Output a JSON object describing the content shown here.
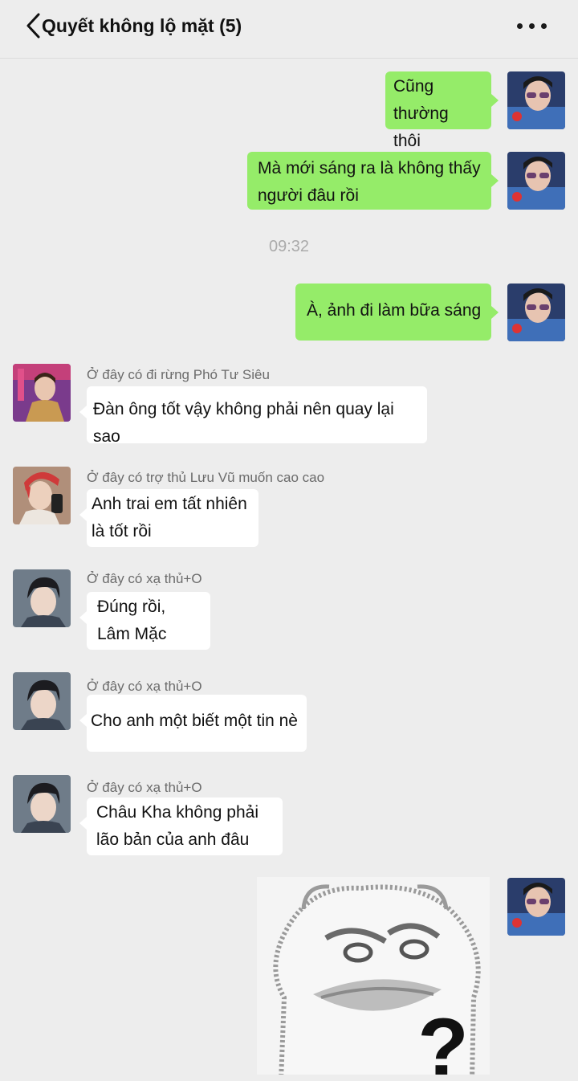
{
  "header": {
    "title": "Quyết không lộ mặt (5)",
    "back_icon": "chevron-left-icon",
    "more_icon": "more-horizontal-icon"
  },
  "timestamp": "09:32",
  "messages": [
    {
      "side": "right",
      "lines": [
        "Cũng thường",
        "thôi"
      ]
    },
    {
      "side": "right",
      "lines": [
        "Mà mới sáng ra là không thấy",
        "người đâu rồi"
      ]
    },
    {
      "side": "right",
      "lines": [
        "À, ảnh đi làm bữa sáng"
      ]
    },
    {
      "side": "left",
      "sender": "Ở đây có đi rừng Phó Tư Siêu",
      "lines": [
        "Đàn ông tốt vậy không phải nên quay lại sao"
      ]
    },
    {
      "side": "left",
      "sender": "Ở đây có trợ thủ Lưu Vũ muốn cao cao",
      "lines": [
        "Anh trai em tất nhiên",
        "là tốt rồi"
      ]
    },
    {
      "side": "left",
      "sender": "Ở đây có xạ thủ+O",
      "lines": [
        "Đúng rồi,",
        "Lâm Mặc"
      ]
    },
    {
      "side": "left",
      "sender": "Ở đây có xạ thủ+O",
      "lines": [
        "Cho anh một biết một tin nè"
      ]
    },
    {
      "side": "left",
      "sender": "Ở đây có xạ thủ+O",
      "lines": [
        "Châu Kha không phải",
        "lão bản của anh đâu"
      ]
    }
  ],
  "sticker": {
    "glyph": "?",
    "icon": "confused-face-sticker"
  },
  "colors": {
    "green_bubble": "#95ec69",
    "background": "#ededed"
  }
}
